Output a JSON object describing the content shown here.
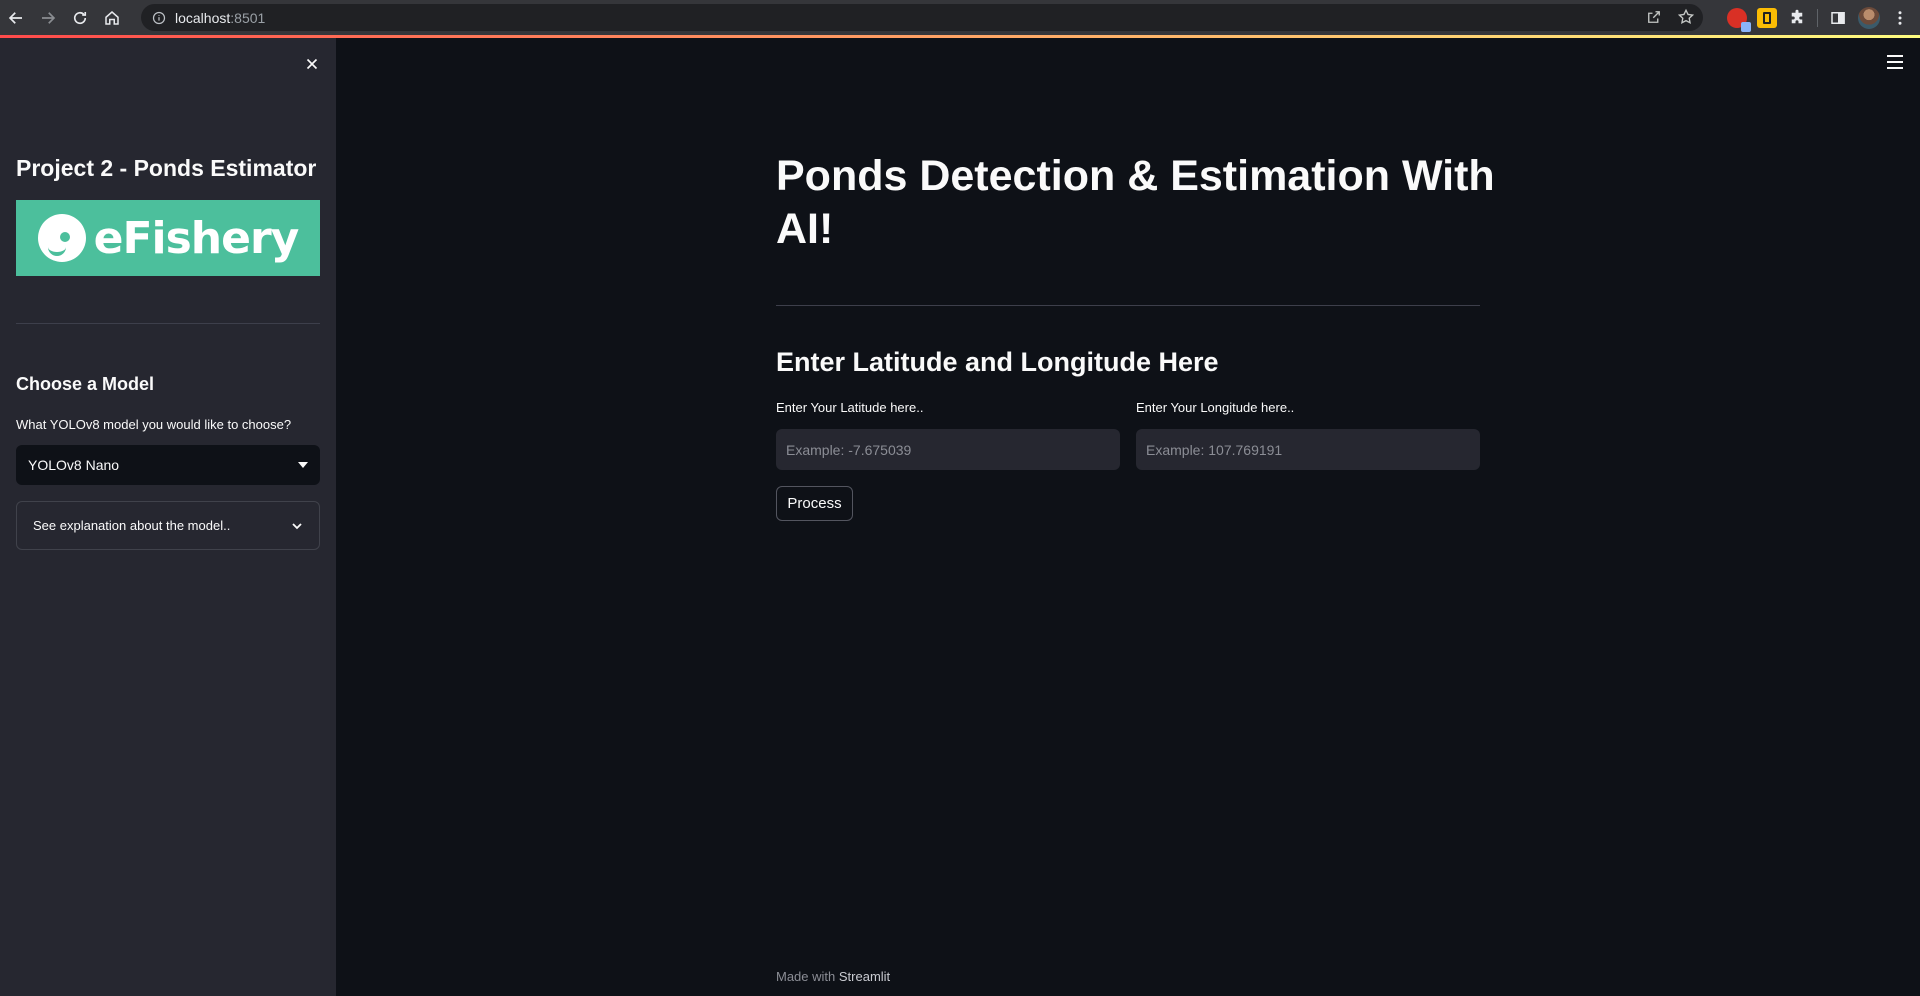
{
  "browser": {
    "url_host": "localhost",
    "url_port": ":8501"
  },
  "sidebar": {
    "title": "Project 2 - Ponds Estimator",
    "logo_text": "eFishery",
    "model_heading": "Choose a Model",
    "model_label": "What YOLOv8 model you would like to choose?",
    "model_selected": "YOLOv8 Nano",
    "expander_label": "See explanation about the model.."
  },
  "main": {
    "title": "Ponds Detection & Estimation With AI!",
    "section_heading": "Enter Latitude and Longitude Here",
    "latitude_label": "Enter Your Latitude here..",
    "latitude_placeholder": "Example: -7.675039",
    "longitude_label": "Enter Your Longitude here..",
    "longitude_placeholder": "Example: 107.769191",
    "process_button": "Process"
  },
  "footer": {
    "prefix": "Made with",
    "link": "Streamlit"
  },
  "colors": {
    "app_background": "#0e1117",
    "sidebar_background": "#262730",
    "logo_background": "#4cbf9c",
    "header_gradient_start": "#ff4b4b",
    "header_gradient_end": "#fffd80"
  }
}
